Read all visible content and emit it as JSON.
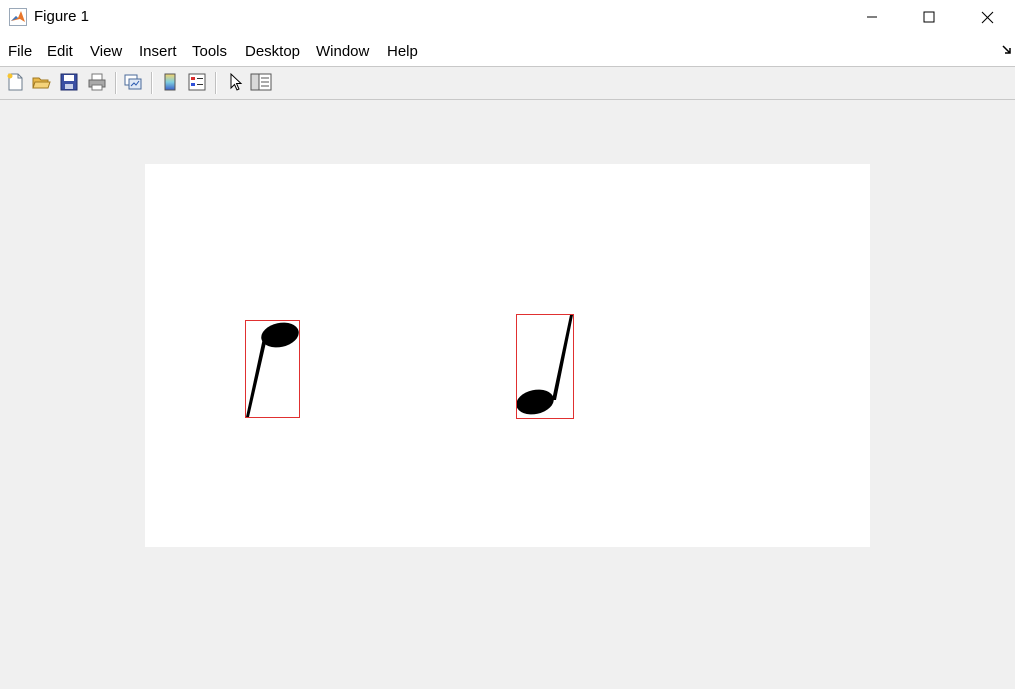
{
  "window": {
    "title": "Figure 1",
    "controls": [
      "minimize",
      "maximize",
      "close"
    ]
  },
  "menubar": {
    "items": [
      {
        "label": "File"
      },
      {
        "label": "Edit"
      },
      {
        "label": "View"
      },
      {
        "label": "Insert"
      },
      {
        "label": "Tools"
      },
      {
        "label": "Desktop"
      },
      {
        "label": "Window"
      },
      {
        "label": "Help"
      }
    ]
  },
  "toolbar": {
    "tools": [
      {
        "icon": "new-figure-icon"
      },
      {
        "icon": "open-file-icon"
      },
      {
        "icon": "save-icon"
      },
      {
        "icon": "print-icon"
      },
      {
        "icon": "link-plot-icon"
      },
      {
        "icon": "insert-colorbar-icon"
      },
      {
        "icon": "insert-legend-icon"
      },
      {
        "icon": "edit-plot-pointer-icon"
      },
      {
        "icon": "property-inspector-icon"
      }
    ]
  },
  "figure": {
    "content": "binary image of two music notes with red bounding boxes",
    "bounding_box_color": "#e03030",
    "background_color": "#ffffff",
    "objects": [
      {
        "name": "eighth-note-stem-down"
      },
      {
        "name": "eighth-note-stem-up"
      }
    ]
  }
}
